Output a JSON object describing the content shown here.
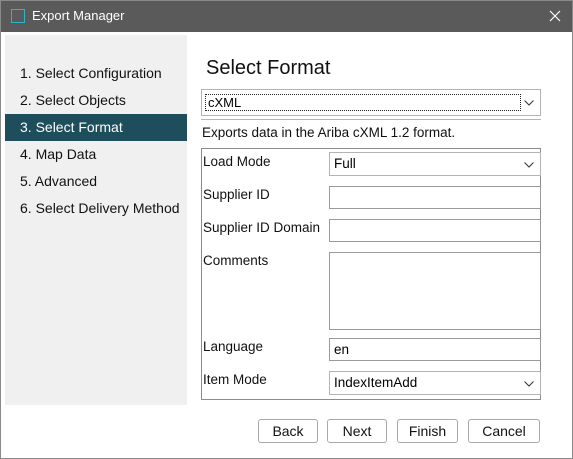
{
  "window": {
    "title": "Export Manager",
    "icon": "window-app-icon",
    "close_icon": "close-icon",
    "accent_color": "#1e4d5c",
    "titlebar_color": "#5a5a5a"
  },
  "sidebar": {
    "items": [
      {
        "label": "1. Select Configuration"
      },
      {
        "label": "2. Select Objects"
      },
      {
        "label": "3. Select Format"
      },
      {
        "label": "4. Map Data"
      },
      {
        "label": "5. Advanced"
      },
      {
        "label": "6. Select Delivery Method"
      }
    ],
    "active_index": 2
  },
  "main": {
    "title": "Select Format",
    "format_select": {
      "value": "cXML"
    },
    "description": "Exports data in the Ariba cXML 1.2 format.",
    "fields": {
      "load_mode": {
        "label": "Load Mode",
        "value": "Full"
      },
      "supplier_id": {
        "label": "Supplier ID",
        "value": ""
      },
      "supplier_id_domain": {
        "label": "Supplier ID Domain",
        "value": ""
      },
      "comments": {
        "label": "Comments",
        "value": ""
      },
      "language": {
        "label": "Language",
        "value": "en"
      },
      "item_mode": {
        "label": "Item Mode",
        "value": "IndexItemAdd"
      }
    }
  },
  "buttons": {
    "back": "Back",
    "next": "Next",
    "finish": "Finish",
    "cancel": "Cancel"
  }
}
